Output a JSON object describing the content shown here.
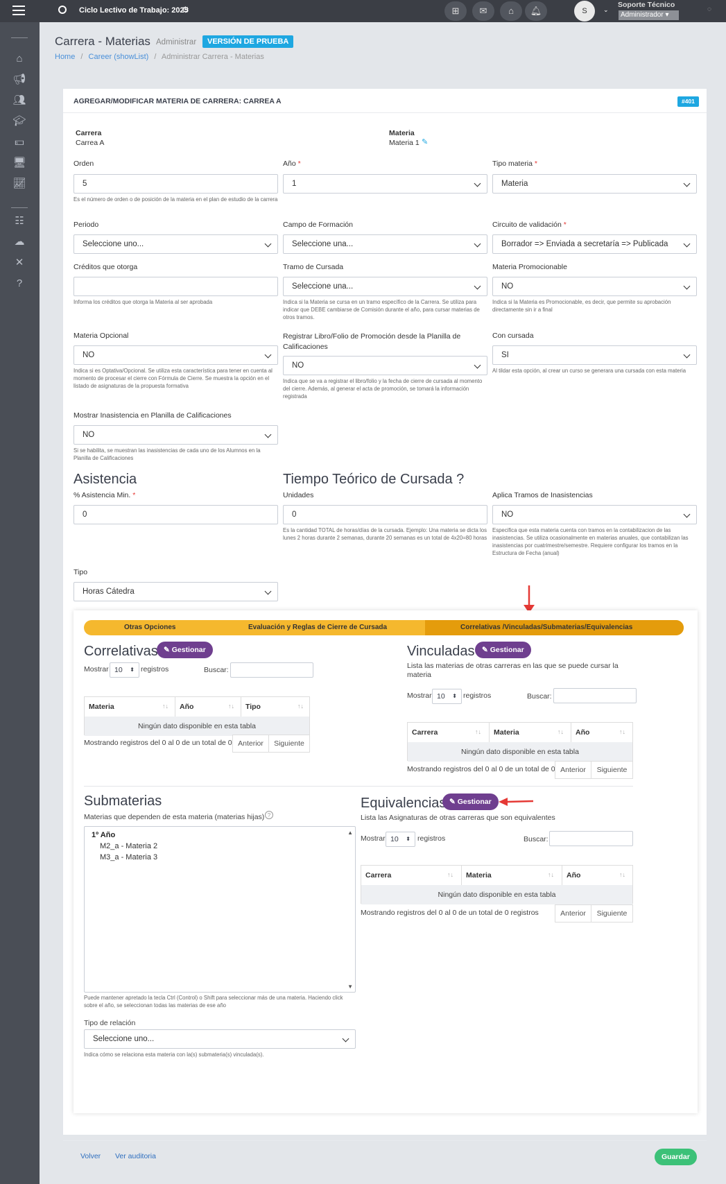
{
  "topbar": {
    "cycle": "Ciclo Lectivo de Trabajo: 2025",
    "user": "Soporte Técnico",
    "role": "Administrador",
    "avatar": "S"
  },
  "header": {
    "title": "Carrera - Materias",
    "subtitle": "Administrar",
    "badge": "VERSIÓN DE PRUEBA",
    "crumbs": [
      "Home",
      "Career (showList)",
      "Administrar Carrera - Materias"
    ],
    "sep": "/"
  },
  "card": {
    "title": "AGREGAR/MODIFICAR MATERIA DE CARRERA: CARREA A",
    "id_badge": "#401"
  },
  "info": {
    "carrera_label": "Carrera",
    "carrera_value": "Carrea A",
    "materia_label": "Materia",
    "materia_value": "Materia 1"
  },
  "fields": {
    "orden": {
      "label": "Orden",
      "value": "5",
      "help": "Es el número de orden o de posición de la materia en el plan de estudio de la carrera"
    },
    "anio": {
      "label": "Año",
      "value": "1"
    },
    "tipo": {
      "label": "Tipo materia",
      "value": "Materia"
    },
    "periodo": {
      "label": "Periodo",
      "value": "Seleccione uno..."
    },
    "campo": {
      "label": "Campo de Formación",
      "value": "Seleccione una..."
    },
    "circuito": {
      "label": "Circuito de validación",
      "value": "Borrador => Enviada a secretaría => Publicada"
    },
    "creditos": {
      "label": "Créditos que otorga",
      "value": "",
      "help": "Informa los créditos que otorga la Materia al ser aprobada"
    },
    "tramo": {
      "label": "Tramo de Cursada",
      "value": "Seleccione una...",
      "help": "Indica si la Materia se cursa en un tramo específico de la Carrera. Se utiliza para indicar que DEBE cambiarse de Comisión durante el año, para cursar materias de otros tramos."
    },
    "promo": {
      "label": "Materia Promocionable",
      "value": "NO",
      "help": "Indica si la Materia es Promocionable, es decir, que permite su aprobación directamente sin ir a final"
    },
    "opcional": {
      "label": "Materia Opcional",
      "value": "NO",
      "help": "Indica si es Optativa/Opcional. Se utiliza esta característica para tener en cuenta al momento de procesar el cierre con Fórmula de Cierre. Se muestra la opción en el listado de asignaturas de la propuesta formativa"
    },
    "libro": {
      "label": "Registrar Libro/Folio de Promoción desde la Planilla de Calificaciones",
      "value": "NO",
      "help": "Indica que se va a registrar el libro/folio y la fecha de cierre de cursada al momento del cierre. Además, al generar el acta de promoción, se tomará la información registrada"
    },
    "cursada": {
      "label": "Con cursada",
      "value": "SI",
      "help": "Al tildar esta opción, al crear un curso se generara una cursada con esta materia"
    },
    "inasist": {
      "label": "Mostrar Inasistencia en Planilla de Calificaciones",
      "value": "NO",
      "help": "Si se habilita, se muestran las inasistencias de cada uno de los Alumnos en la Planilla de Calificaciones"
    },
    "asistencia": {
      "label": "% Asistencia Min.",
      "value": "0"
    },
    "unidades": {
      "label": "Unidades",
      "value": "0",
      "help": "Es la cantidad TOTAL de horas/días de la cursada. Ejemplo: Una materia se dicta los lunes 2 horas durante 2 semanas, durante 20 semanas es un total de 4x20=80 horas"
    },
    "tramos_inas": {
      "label": "Aplica Tramos de Inasistencias",
      "value": "NO",
      "help": "Especifica que esta materia cuenta con tramos en la contabilizacion de las inasistencias. Se utiliza ocasionalmente en materias anuales, que contabilizan las inasistencias por cuatrimestre/semestre. Requiere configurar los tramos en la Estructura de Fecha (anual)"
    },
    "tipo_horas": {
      "label": "Tipo",
      "value": "Horas Cátedra"
    }
  },
  "sections": {
    "asistencia": "Asistencia",
    "tiempo": "Tiempo Teórico de Cursada",
    "tiempo_q": "?"
  },
  "tabs": [
    "Otras Opciones",
    "Evaluación y Reglas de Cierre de Cursada",
    "Correlativas /Vinculadas/Submaterias/Equivalencias"
  ],
  "common": {
    "gestionar": "Gestionar",
    "mostrar": "Mostrar",
    "registros": "registros",
    "buscar": "Buscar:",
    "page_len": "10",
    "empty": "Ningún dato disponible en esta tabla",
    "info": "Mostrando registros del 0 al 0 de un total de 0 registros",
    "anterior": "Anterior",
    "siguiente": "Siguiente"
  },
  "correlativas": {
    "title": "Correlativas",
    "cols": [
      "Materia",
      "Año",
      "Tipo"
    ]
  },
  "vinculadas": {
    "title": "Vinculadas",
    "desc": "Lista las materias de otras carreras en las que se puede cursar la materia",
    "cols": [
      "Carrera",
      "Materia",
      "Año"
    ]
  },
  "submaterias": {
    "title": "Submaterias",
    "desc": "Materias que dependen de esta materia (materias hijas)",
    "group": "1º Año",
    "items": [
      "M2_a - Materia 2",
      "M3_a - Materia 3"
    ],
    "help": "Puede mantener apretado la tecla Ctrl (Control) o Shift para seleccionar más de una materia. Haciendo click sobre el año, se seleccionan todas las materias de ese año",
    "rel_label": "Tipo de relación",
    "rel_value": "Seleccione uno...",
    "rel_help": "Indica cómo se relaciona esta materia con la(s) submateria(s) vinculada(s)."
  },
  "equivalencias": {
    "title": "Equivalencias",
    "desc": "Lista las Asignaturas de otras carreras que son equivalentes",
    "cols": [
      "Carrera",
      "Materia",
      "Año"
    ]
  },
  "footer": {
    "volver": "Volver",
    "auditoria": "Ver auditoria",
    "guardar": "Guardar"
  },
  "colors": {
    "accent": "#1ea7e1",
    "tabs": "#f5b82e",
    "purple": "#6f3f8f",
    "green": "#3cc178",
    "arrow": "#e53935"
  }
}
